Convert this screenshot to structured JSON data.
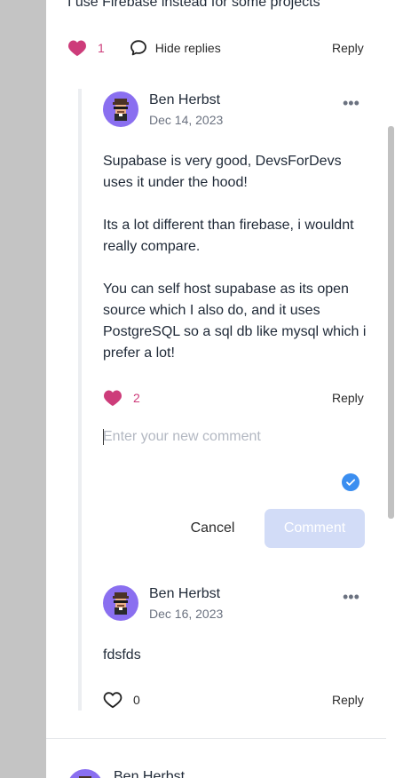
{
  "parent_comment": {
    "text_tail": "I use Firebase instead for some projects",
    "likes": "1",
    "hide_replies_label": "Hide replies",
    "reply_label": "Reply"
  },
  "replies": [
    {
      "author": "Ben Herbst",
      "date": "Dec 14, 2023",
      "paragraphs": [
        "Supabase is very good, DevsForDevs uses it under the hood!",
        "Its a lot different than firebase, i wouldnt really compare.",
        "You can self host supabase as its open source which I also do, and it uses PostgreSQL so a sql db like mysql which i prefer a lot!"
      ],
      "likes": "2",
      "reply_label": "Reply"
    },
    {
      "author": "Ben Herbst",
      "date": "Dec 16, 2023",
      "paragraphs": [
        "fdsfds"
      ],
      "likes": "0",
      "reply_label": "Reply"
    }
  ],
  "composer": {
    "placeholder": "Enter your new comment",
    "value": "",
    "cancel_label": "Cancel",
    "submit_label": "Comment"
  },
  "next_comment": {
    "author": "Ben Herbst"
  },
  "more_icon": "more-horizontal-icon",
  "colors": {
    "like_active": "#cd3c7a",
    "avatar_bg": "#8a6ff0",
    "submit_disabled": "#d2dcf7",
    "check": "#3b8ef0"
  }
}
